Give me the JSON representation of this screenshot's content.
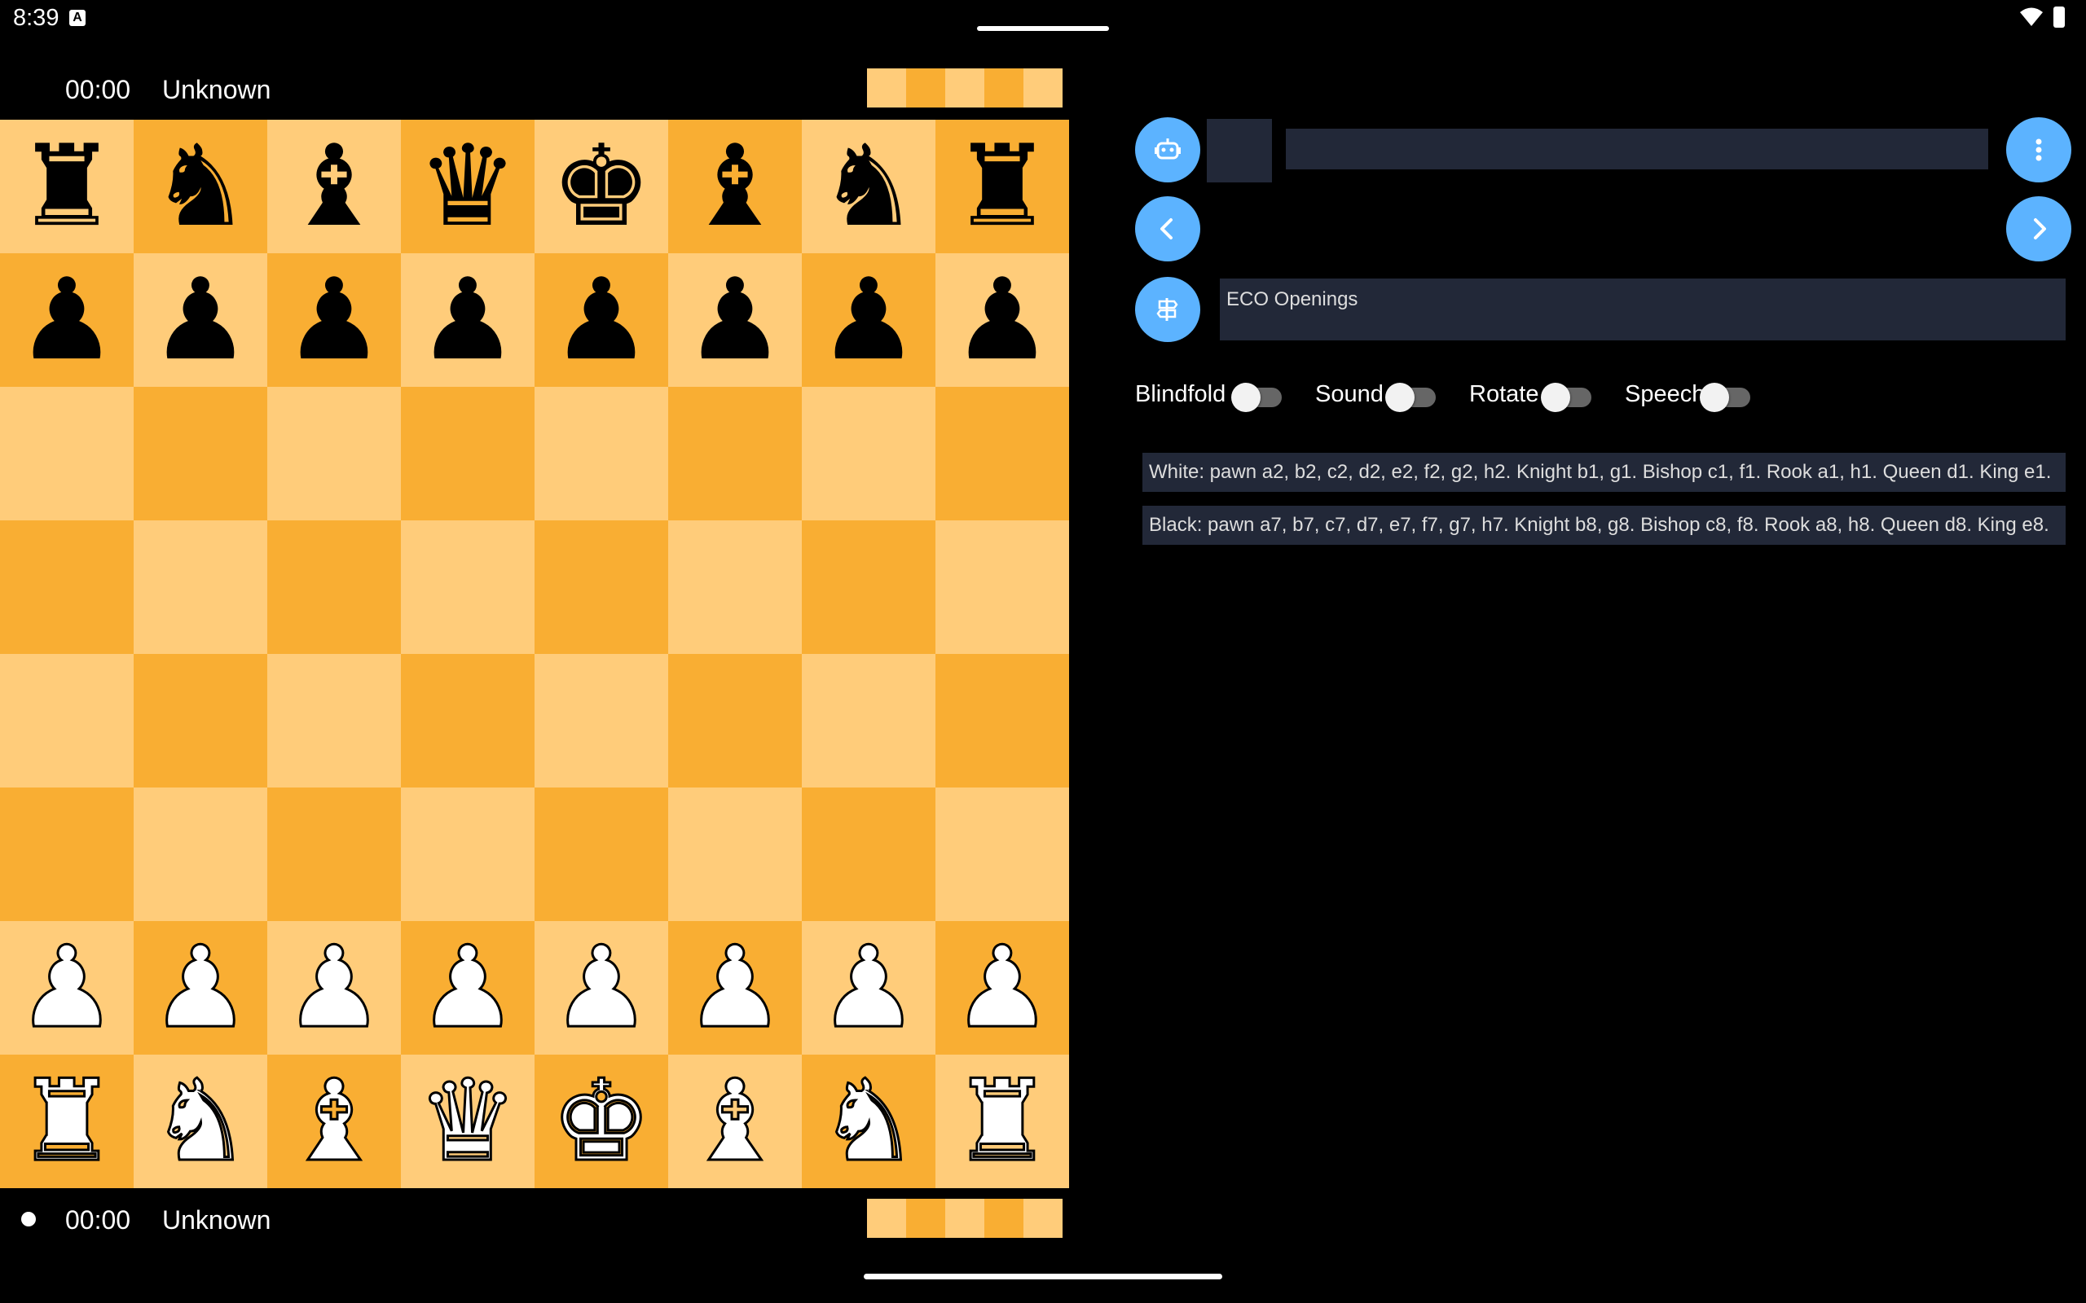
{
  "status": {
    "time": "8:39",
    "notif_icon": "A"
  },
  "top_player": {
    "time": "00:00",
    "name": "Unknown"
  },
  "bottom_player": {
    "time": "00:00",
    "name": "Unknown"
  },
  "captured_colors": [
    "#FFCC7A",
    "#F9AE33",
    "#FFCC7A",
    "#F9AE33",
    "#FFCC7A"
  ],
  "board": {
    "ranks": [
      [
        "br",
        "bn",
        "bb",
        "bq",
        "bk",
        "bb",
        "bn",
        "br"
      ],
      [
        "bp",
        "bp",
        "bp",
        "bp",
        "bp",
        "bp",
        "bp",
        "bp"
      ],
      [
        "",
        "",
        "",
        "",
        "",
        "",
        "",
        ""
      ],
      [
        "",
        "",
        "",
        "",
        "",
        "",
        "",
        ""
      ],
      [
        "",
        "",
        "",
        "",
        "",
        "",
        "",
        ""
      ],
      [
        "",
        "",
        "",
        "",
        "",
        "",
        "",
        ""
      ],
      [
        "wp",
        "wp",
        "wp",
        "wp",
        "wp",
        "wp",
        "wp",
        "wp"
      ],
      [
        "wr",
        "wn",
        "wb",
        "wq",
        "wk",
        "wb",
        "wn",
        "wr"
      ]
    ],
    "light_color": "#FFCC7A",
    "dark_color": "#F9AE33"
  },
  "panel": {
    "engine_icon": "robot-icon",
    "menu_icon": "more-vert-icon",
    "prev_icon": "chevron-left-icon",
    "next_icon": "chevron-right-icon",
    "book_icon": "signpost-icon",
    "eco_label": "ECO Openings",
    "accent": "#5CB3FF"
  },
  "toggles": [
    {
      "label": "Blindfold",
      "on": false
    },
    {
      "label": "Sound",
      "on": false
    },
    {
      "label": "Rotate",
      "on": false
    },
    {
      "label": "Speech",
      "on": false
    }
  ],
  "descriptions": {
    "white": "White: pawn a2, b2, c2, d2, e2, f2, g2, h2. Knight b1, g1. Bishop c1, f1. Rook a1, h1. Queen d1. King e1.",
    "black": "Black: pawn a7, b7, c7, d7, e7, f7, g7, h7. Knight b8, g8. Bishop c8, f8. Rook a8, h8. Queen d8. King e8."
  }
}
